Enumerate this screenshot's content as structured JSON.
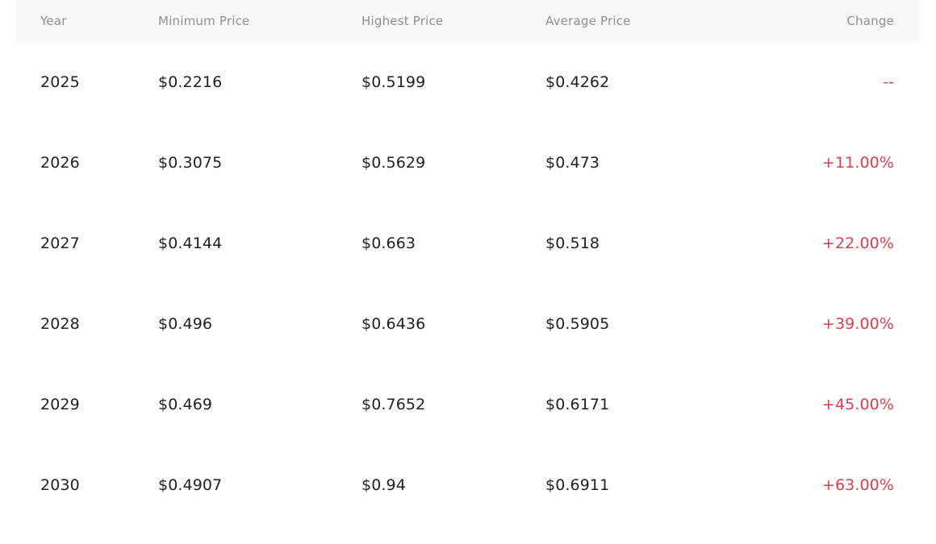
{
  "table": {
    "columns": {
      "year": "Year",
      "min": "Minimum Price",
      "high": "Highest Price",
      "avg": "Average Price",
      "change": "Change"
    },
    "rows": [
      {
        "year": "2025",
        "min": "$0.2216",
        "high": "$0.5199",
        "avg": "$0.4262",
        "change": "--"
      },
      {
        "year": "2026",
        "min": "$0.3075",
        "high": "$0.5629",
        "avg": "$0.473",
        "change": "+11.00%"
      },
      {
        "year": "2027",
        "min": "$0.4144",
        "high": "$0.663",
        "avg": "$0.518",
        "change": "+22.00%"
      },
      {
        "year": "2028",
        "min": "$0.496",
        "high": "$0.6436",
        "avg": "$0.5905",
        "change": "+39.00%"
      },
      {
        "year": "2029",
        "min": "$0.469",
        "high": "$0.7652",
        "avg": "$0.6171",
        "change": "+45.00%"
      },
      {
        "year": "2030",
        "min": "$0.4907",
        "high": "$0.94",
        "avg": "$0.6911",
        "change": "+63.00%"
      }
    ]
  },
  "colors": {
    "header_bg": "#f7f8fa",
    "header_text": "#8c8f96",
    "body_text": "#1e2026",
    "change_text": "#e03c4e"
  }
}
